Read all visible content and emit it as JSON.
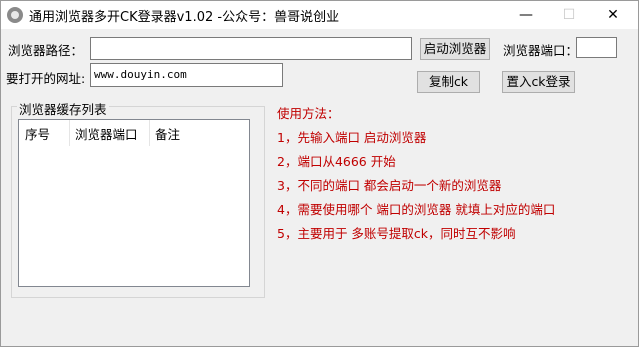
{
  "window": {
    "title": "通用浏览器多开CK登录器v1.02 -公众号：兽哥说创业",
    "minimize": "—",
    "maximize": "☐",
    "close": "✕"
  },
  "form": {
    "path_label": "浏览器路径：",
    "path_value": "",
    "launch_button": "启动浏览器",
    "port_label": "浏览器端口：",
    "port_value": "",
    "url_label": "要打开的网址:",
    "url_value": "www.douyin.com",
    "copy_button": "复制ck",
    "import_button": "置入ck登录"
  },
  "cache": {
    "title": "浏览器缓存列表",
    "columns": [
      "序号",
      "浏览器端口",
      "备注"
    ],
    "rows": []
  },
  "usage": {
    "title": "使用方法：",
    "steps": [
      "1，先输入端口 启动浏览器",
      "2，端口从4666 开始",
      "3，不同的端口 都会启动一个新的浏览器",
      "4，需要使用哪个 端口的浏览器  就填上对应的端口",
      "5，主要用于 多账号提取ck，同时互不影响"
    ]
  }
}
